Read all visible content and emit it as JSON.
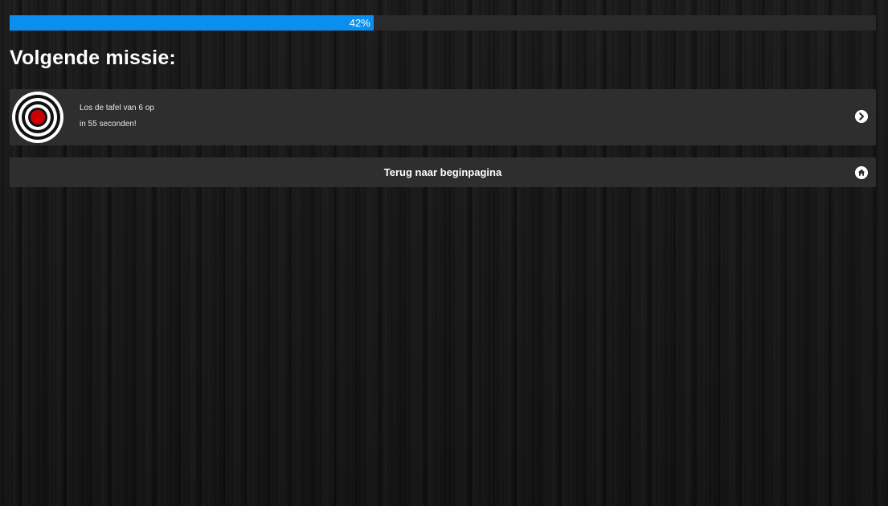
{
  "progress": {
    "value_percent": 42,
    "label": "42%",
    "color": "#0a8ff0"
  },
  "heading": "Volgende missie:",
  "mission": {
    "icon": "target-icon",
    "line1": "Los de tafel van 6 op",
    "line2": "in 55 seconden!",
    "action_icon": "chevron-right-icon"
  },
  "home_button": {
    "label": "Terug naar beginpagina",
    "icon": "home-icon"
  }
}
